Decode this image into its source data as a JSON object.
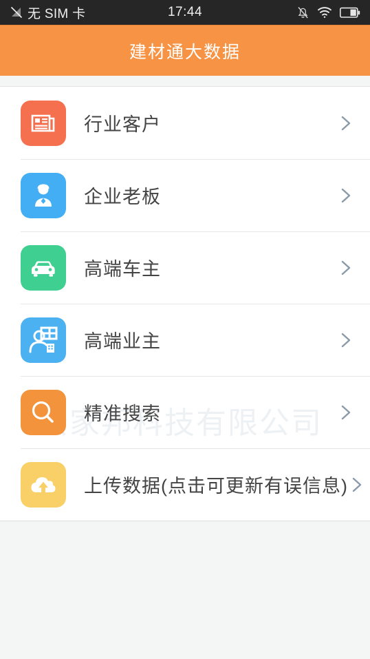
{
  "status_bar": {
    "carrier": "无 SIM 卡",
    "time": "17:44",
    "icons": {
      "signal": "signal-off-icon",
      "silent": "bell-muted-icon",
      "wifi": "wifi-icon",
      "battery": "battery-icon"
    }
  },
  "header": {
    "title": "建材通大数据",
    "background_color": "#f79344",
    "title_color": "#ffffff"
  },
  "watermark": {
    "text": "宏家邦科技有限公司",
    "color": "#eef1f4"
  },
  "list": {
    "items": [
      {
        "label": "行业客户",
        "icon": "newspaper-icon",
        "icon_bg": "#f4704f",
        "chevron": "chevron-right-icon"
      },
      {
        "label": "企业老板",
        "icon": "businessman-icon",
        "icon_bg": "#44aef4",
        "chevron": "chevron-right-icon"
      },
      {
        "label": "高端车主",
        "icon": "car-icon",
        "icon_bg": "#3fcf90",
        "chevron": "chevron-right-icon"
      },
      {
        "label": "高端业主",
        "icon": "property-owner-icon",
        "icon_bg": "#4cb1f0",
        "chevron": "chevron-right-icon"
      },
      {
        "label": "精准搜索",
        "icon": "search-icon",
        "icon_bg": "#f3933c",
        "chevron": "chevron-right-icon"
      },
      {
        "label": "上传数据(点击可更新有误信息)",
        "icon": "cloud-upload-icon",
        "icon_bg": "#f9d068",
        "chevron": "chevron-right-icon"
      }
    ]
  }
}
